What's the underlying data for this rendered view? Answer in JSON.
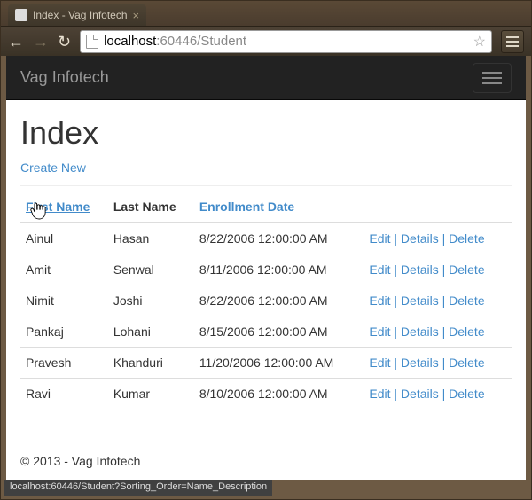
{
  "browser": {
    "tab_title": "Index - Vag Infotech",
    "url_host": "localhost",
    "url_port": ":60446",
    "url_path": "/Student",
    "status_url": "localhost:60446/Student?Sorting_Order=Name_Description"
  },
  "navbar": {
    "brand": "Vag Infotech"
  },
  "page": {
    "heading": "Index",
    "create_label": "Create New",
    "footer": "© 2013 - Vag Infotech"
  },
  "table": {
    "headers": {
      "first_name": "First Name",
      "last_name": "Last Name",
      "enroll": "Enrollment Date"
    },
    "actions": {
      "edit": "Edit",
      "details": "Details",
      "delete": "Delete",
      "sep": " | "
    },
    "rows": [
      {
        "first": "Ainul",
        "last": "Hasan",
        "date": "8/22/2006 12:00:00 AM"
      },
      {
        "first": "Amit",
        "last": "Senwal",
        "date": "8/11/2006 12:00:00 AM"
      },
      {
        "first": "Nimit",
        "last": "Joshi",
        "date": "8/22/2006 12:00:00 AM"
      },
      {
        "first": "Pankaj",
        "last": "Lohani",
        "date": "8/15/2006 12:00:00 AM"
      },
      {
        "first": "Pravesh",
        "last": "Khanduri",
        "date": "11/20/2006 12:00:00 AM"
      },
      {
        "first": "Ravi",
        "last": "Kumar",
        "date": "8/10/2006 12:00:00 AM"
      }
    ]
  }
}
